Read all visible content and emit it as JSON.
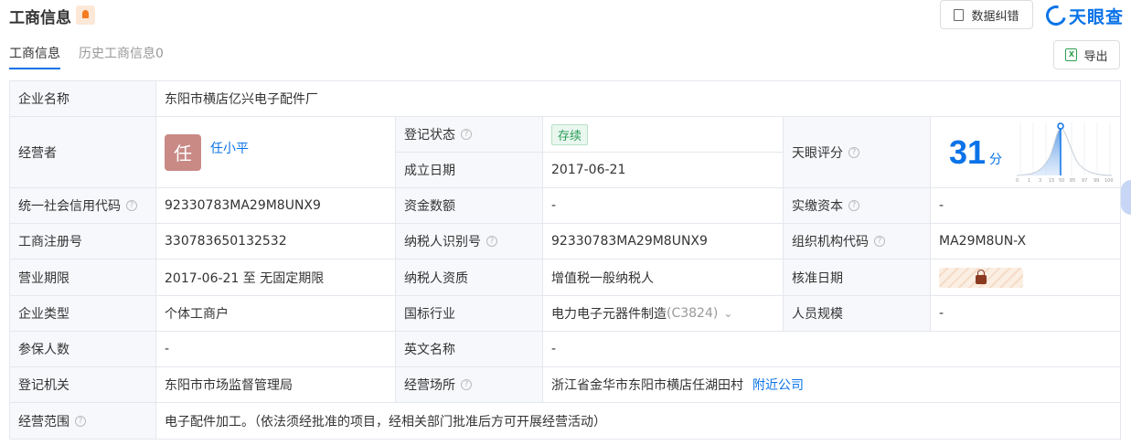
{
  "header": {
    "title": "工商信息",
    "correct_label": "数据纠错",
    "logo_text": "天眼查"
  },
  "tabs": [
    {
      "label": "工商信息"
    },
    {
      "label": "历史工商信息0"
    }
  ],
  "export_label": "导出",
  "info": {
    "company_name_label": "企业名称",
    "company_name": "东阳市横店亿兴电子配件厂",
    "operator_label": "经营者",
    "operator_avatar": "任",
    "operator_name": "任小平",
    "status_label": "登记状态",
    "status": "存续",
    "found_date_label": "成立日期",
    "found_date": "2017-06-21",
    "score_label": "天眼评分",
    "score": "31",
    "score_unit": "分",
    "score_ticks": [
      "0",
      "1",
      "3",
      "15",
      "50",
      "85",
      "97",
      "99",
      "100"
    ],
    "credit_code_label": "统一社会信用代码",
    "credit_code": "92330783MA29M8UNX9",
    "capital_label": "资金数额",
    "capital": "-",
    "paid_capital_label": "实缴资本",
    "paid_capital": "-",
    "reg_no_label": "工商注册号",
    "reg_no": "330783650132532",
    "taxpayer_id_label": "纳税人识别号",
    "taxpayer_id": "92330783MA29M8UNX9",
    "org_code_label": "组织机构代码",
    "org_code": "MA29M8UN-X",
    "term_label": "营业期限",
    "term": "2017-06-21 至 无固定期限",
    "taxpayer_qual_label": "纳税人资质",
    "taxpayer_qual": "增值税一般纳税人",
    "approve_date_label": "核准日期",
    "type_label": "企业类型",
    "type": "个体工商户",
    "industry_label": "国标行业",
    "industry": "电力电子元器件制造",
    "industry_code": "(C3824)",
    "staff_label": "人员规模",
    "staff": "-",
    "insured_label": "参保人数",
    "insured": "-",
    "en_name_label": "英文名称",
    "en_name": "-",
    "authority_label": "登记机关",
    "authority": "东阳市市场监督管理局",
    "address_label": "经营场所",
    "address": "浙江省金华市东阳市横店任湖田村",
    "nearby_label": "附近公司",
    "scope_label": "经营范围",
    "scope": "电子配件加工。（依法须经批准的项目，经相关部门批准后方可开展经营活动）"
  },
  "colors": {
    "accent": "#0a73e8",
    "status_green": "#2a9d56",
    "label_bg": "#f6f8fb"
  }
}
